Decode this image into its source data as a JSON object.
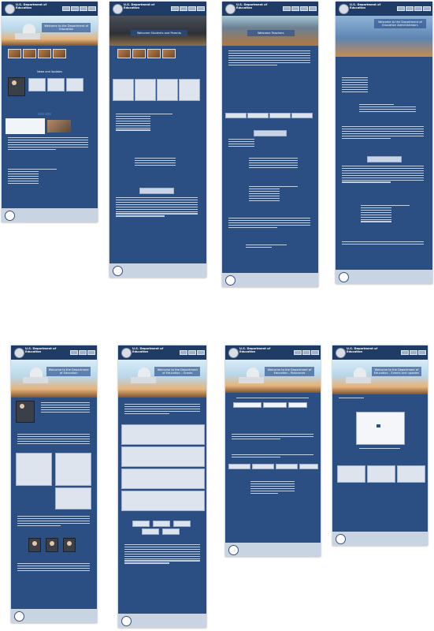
{
  "site": {
    "brand_line1": "U.S. Department of",
    "brand_line2": "Education"
  },
  "panels": [
    {
      "id": "p1",
      "hero_title": "Welcome to the Department of Education",
      "section_title": "News and Updates"
    },
    {
      "id": "p2",
      "hero_title": "Welcome Students and Parents"
    },
    {
      "id": "p3",
      "hero_title": "Welcome Teachers"
    },
    {
      "id": "p4",
      "hero_title": "Welcome to the Department of Education Administrators"
    },
    {
      "id": "p5",
      "hero_title": "Welcome to the Department of Education"
    },
    {
      "id": "p6",
      "hero_title": "Welcome to the Department of Education - Grants"
    },
    {
      "id": "p7",
      "hero_title": "Welcome to the Department of Education - Resources"
    },
    {
      "id": "p8",
      "hero_title": "Welcome to the Department of Education - Events and updates"
    }
  ]
}
